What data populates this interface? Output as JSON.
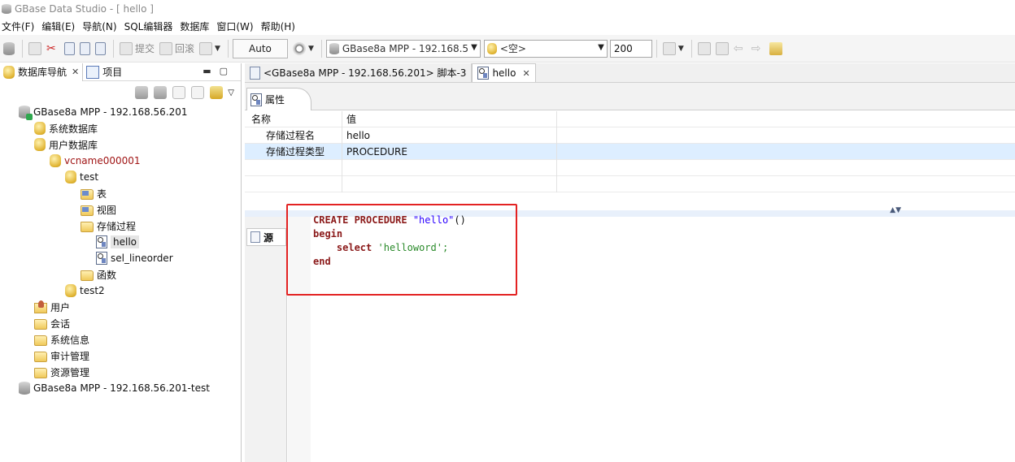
{
  "window": {
    "title": "GBase Data Studio - [ hello ]"
  },
  "menu": [
    "文件(F)",
    "编辑(E)",
    "导航(N)",
    "SQL编辑器",
    "数据库",
    "窗口(W)",
    "帮助(H)"
  ],
  "toolbar": {
    "submit_label": "提交",
    "rollback_label": "回滚",
    "auto_label": "Auto",
    "connection_value": "GBase8a MPP - 192.168.5",
    "schema_value": "<空>",
    "max_rows_value": "200"
  },
  "left_panel": {
    "tabs": [
      {
        "label": "数据库导航"
      },
      {
        "label": "项目"
      }
    ],
    "tree": [
      {
        "label": "GBase8a MPP - 192.168.56.201",
        "icon": "server-icon"
      },
      {
        "label": "系统数据库",
        "icon": "database-group-icon"
      },
      {
        "label": "用户数据库",
        "icon": "database-group-icon"
      },
      {
        "label": "vcname000001",
        "icon": "cluster-icon"
      },
      {
        "label": "test",
        "icon": "database-icon"
      },
      {
        "label": "表",
        "icon": "table-folder-icon"
      },
      {
        "label": "视图",
        "icon": "view-folder-icon"
      },
      {
        "label": "存储过程",
        "icon": "folder-icon"
      },
      {
        "label": "hello",
        "icon": "procedure-icon"
      },
      {
        "label": "sel_lineorder",
        "icon": "procedure-icon"
      },
      {
        "label": "函数",
        "icon": "folder-icon"
      },
      {
        "label": "test2",
        "icon": "database-icon"
      },
      {
        "label": "用户",
        "icon": "user-folder-icon"
      },
      {
        "label": "会话",
        "icon": "session-folder-icon"
      },
      {
        "label": "系统信息",
        "icon": "info-folder-icon"
      },
      {
        "label": "审计管理",
        "icon": "audit-folder-icon"
      },
      {
        "label": "资源管理",
        "icon": "resource-folder-icon"
      },
      {
        "label": "GBase8a MPP - 192.168.56.201-test",
        "icon": "server-icon"
      }
    ]
  },
  "editor": {
    "tabs": [
      {
        "label": "<GBase8a MPP - 192.168.56.201> 脚本-3"
      },
      {
        "label": "hello"
      }
    ],
    "properties": {
      "tab_label": "属性",
      "headers": [
        "名称",
        "值"
      ],
      "rows": [
        {
          "name": "存储过程名",
          "value": "hello"
        },
        {
          "name": "存储过程类型",
          "value": "PROCEDURE"
        }
      ]
    },
    "source": {
      "tab_label": "源",
      "code": {
        "l1_kw": "CREATE PROCEDURE",
        "l1_str": "\"hello\"",
        "l1_rest": "()",
        "l2": "begin",
        "l3_kw": "select",
        "l3_str": "'helloword';",
        "l4": "end"
      }
    }
  },
  "colors": {
    "highlight_box": "#e32222",
    "selected_row": "#ddeeff"
  }
}
